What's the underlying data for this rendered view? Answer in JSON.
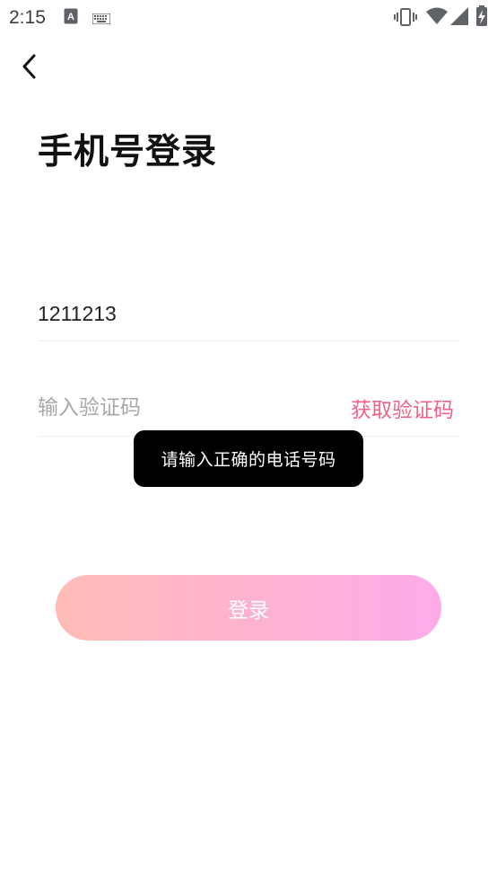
{
  "status_bar": {
    "time": "2:15",
    "icons": [
      "text-a-icon",
      "keyboard-icon",
      "vibrate-icon",
      "wifi-icon",
      "signal-icon",
      "battery-charging-icon"
    ]
  },
  "header": {
    "back_icon": "chevron-left-icon",
    "title": "手机号登录"
  },
  "form": {
    "phone_value": "1211213",
    "code_placeholder": "输入验证码",
    "get_code_label": "获取验证码",
    "login_label": "登录"
  },
  "toast": {
    "message": "请输入正确的电话号码"
  },
  "colors": {
    "accent": "#f06287",
    "button_gradient_start": "#ffbcb6",
    "button_gradient_end": "#ffabea"
  }
}
